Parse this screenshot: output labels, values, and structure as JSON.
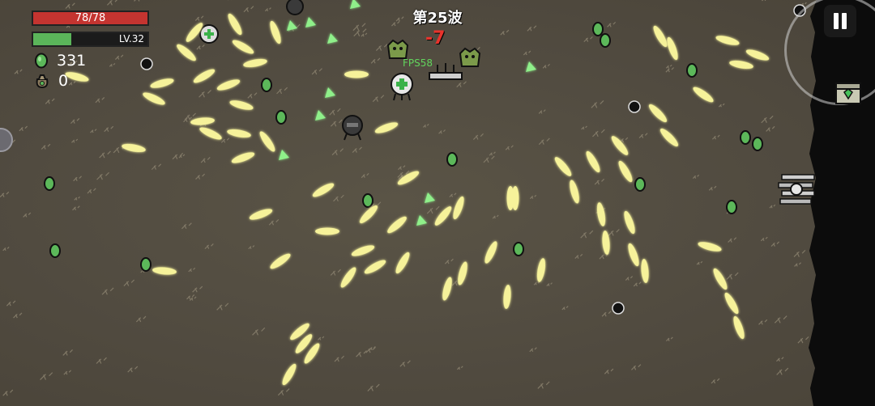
{
  "hud": {
    "hp_text": "78/78",
    "hp_fraction": 1.0,
    "level_text": "LV.32",
    "xp_fraction": 0.33,
    "materials_count": "331",
    "bag_count": "0",
    "hp_color": "#c43430",
    "xp_color": "#5bb55a"
  },
  "wave": {
    "label": "第25波"
  },
  "damage_popup": {
    "text": "-7",
    "color": "#e8332c"
  },
  "fps": {
    "text": "FPS58"
  },
  "controls": {
    "pause_icon": "pause-icon",
    "chest_icon": "loot-crate-icon"
  },
  "palette": {
    "ground": "#514b40",
    "bullet": "#f6f29a",
    "bullet_glow": "#fff8c8",
    "material": "#5cb85a",
    "shard": "#8ff08a",
    "void": "#0c0c0c"
  }
}
